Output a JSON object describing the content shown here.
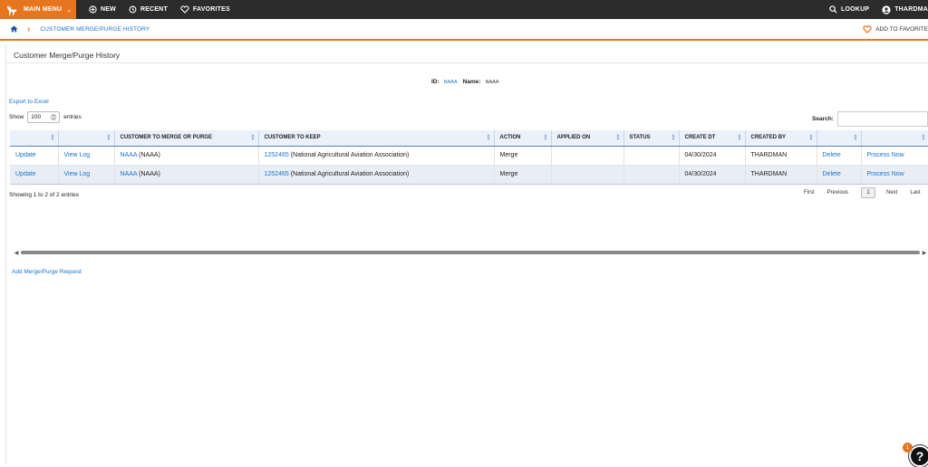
{
  "nav": {
    "main_menu": "MAIN MENU",
    "new": "NEW",
    "recent": "RECENT",
    "favorites": "FAVORITES",
    "lookup": "LOOKUP",
    "user": "THARDMA"
  },
  "breadcrumb": {
    "current": "CUSTOMER MERGE/PURGE HISTORY",
    "add_favorite": "ADD TO FAVORITE"
  },
  "panel": {
    "title": "Customer Merge/Purge History",
    "id_label": "ID:",
    "id_value": "NAAA",
    "name_label": "Name:",
    "name_value": "NAAA"
  },
  "controls": {
    "export": "Export to Excel",
    "show_label": "Show",
    "show_value": "100",
    "entries_label": "entries",
    "search_label": "Search:"
  },
  "table": {
    "headers": [
      "",
      "",
      "CUSTOMER TO MERGE OR PURGE",
      "CUSTOMER TO KEEP",
      "ACTION",
      "APPLIED ON",
      "STATUS",
      "CREATE DT",
      "CREATED BY",
      "",
      ""
    ],
    "rows": [
      {
        "update": "Update",
        "view_log": "View Log",
        "merge_link": "NAAA",
        "merge_text": " (NAAA)",
        "keep_link": "1252465",
        "keep_text": " (National Agricultural Aviation Association)",
        "action": "Merge",
        "applied_on": "",
        "status": "",
        "create_dt": "04/30/2024",
        "created_by": "THARDMAN",
        "delete": "Delete",
        "process": "Process Now"
      },
      {
        "update": "Update",
        "view_log": "View Log",
        "merge_link": "NAAA",
        "merge_text": " (NAAA)",
        "keep_link": "1252465",
        "keep_text": " (National Agricultural Aviation Association)",
        "action": "Merge",
        "applied_on": "",
        "status": "",
        "create_dt": "04/30/2024",
        "created_by": "THARDMAN",
        "delete": "Delete",
        "process": "Process Now"
      }
    ]
  },
  "footer": {
    "info": "Showing 1 to 2 of 2 entries",
    "first": "First",
    "previous": "Previous",
    "page": "1",
    "next": "Next",
    "last": "Last",
    "add_request": "Add Merge/Purge Request"
  },
  "help": {
    "badge": "1",
    "glyph": "?"
  },
  "colors": {
    "accent": "#e5761f",
    "link": "#1a73c9",
    "topbar": "#2c2c2c"
  }
}
